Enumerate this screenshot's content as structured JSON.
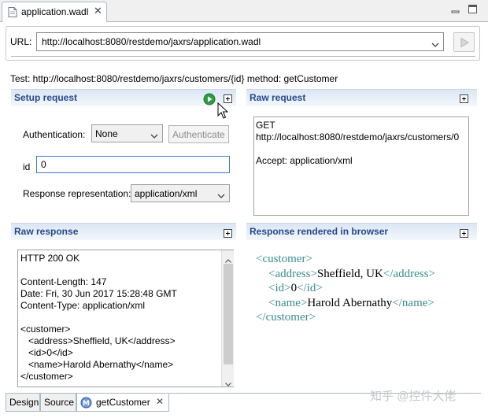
{
  "editor_tab": {
    "title": "application.wadl"
  },
  "url": {
    "label": "URL:",
    "value": "http://localhost:8080/restdemo/jaxrs/application.wadl"
  },
  "test_line": "Test: http://localhost:8080/restdemo/jaxrs/customers/{id} method: getCustomer",
  "setup": {
    "title": "Setup request",
    "auth_label": "Authentication:",
    "auth_value": "None",
    "authenticate_button": "Authenticate",
    "id_label": "id",
    "id_value": "0",
    "repr_label": "Response representation:",
    "repr_value": "application/xml"
  },
  "raw_request": {
    "title": "Raw request",
    "lines": [
      "GET",
      "http://localhost:8080/restdemo/jaxrs/customers/0",
      "",
      "Accept: application/xml"
    ]
  },
  "raw_response": {
    "title": "Raw response",
    "lines": [
      "HTTP 200 OK",
      "",
      "Content-Length: 147",
      "Date: Fri, 30 Jun 2017 15:28:48 GMT",
      "Content-Type: application/xml",
      "",
      "<customer>",
      "   <address>Sheffield, UK</address>",
      "   <id>0</id>",
      "   <name>Harold Abernathy</name>",
      "</customer>"
    ]
  },
  "rendered": {
    "title": "Response rendered in browser",
    "xml": [
      {
        "indent": 0,
        "open": "<customer>",
        "text": "",
        "close": ""
      },
      {
        "indent": 1,
        "open": "<address>",
        "text": "Sheffield, UK",
        "close": "</address>"
      },
      {
        "indent": 1,
        "open": "<id>",
        "text": "0",
        "close": "</id>"
      },
      {
        "indent": 1,
        "open": "<name>",
        "text": "Harold Abernathy",
        "close": "</name>"
      },
      {
        "indent": 0,
        "open": "</customer>",
        "text": "",
        "close": ""
      }
    ]
  },
  "bottom_tabs": {
    "design": "Design",
    "source": "Source",
    "method": "getCustomer"
  },
  "watermark": "知乎 @控件大佬",
  "colors": {
    "section_title": "#254a88",
    "xml_tag": "#3b8c8c",
    "run_icon": "#2e9e3e",
    "focus_border": "#3a7bd5"
  }
}
